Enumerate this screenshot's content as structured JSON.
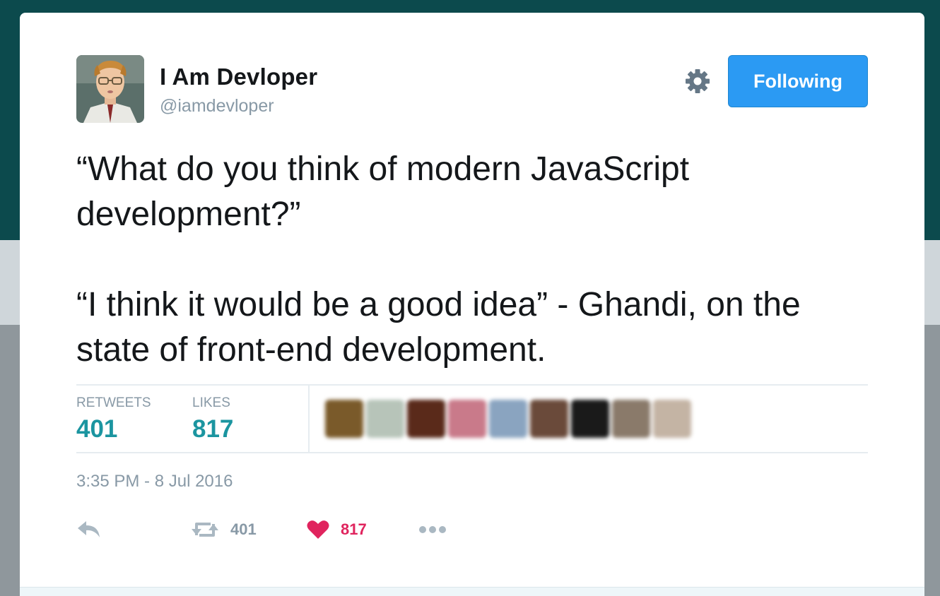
{
  "user": {
    "display_name": "I Am Devloper",
    "handle": "@iamdevloper"
  },
  "header": {
    "settings_icon": "gear-icon",
    "follow_label": "Following",
    "follow_color": "#2b9af3"
  },
  "tweet": {
    "paragraph1": "“What do you think of modern JavaScript development?”",
    "paragraph2": "“I think it would be a good idea” - Ghandi, on the state of front-end development."
  },
  "stats": {
    "retweets_label": "RETWEETS",
    "retweets_value": "401",
    "likes_label": "LIKES",
    "likes_value": "817",
    "liker_avatar_colors": [
      "#7a5a2a",
      "#b7c4b9",
      "#5a2a1a",
      "#c97a8a",
      "#8aa4c0",
      "#6a4a3a",
      "#1a1a1a",
      "#8a7a6a",
      "#c4b4a4"
    ]
  },
  "timestamp": "3:35 PM - 8 Jul 2016",
  "actions": {
    "reply_icon": "reply-icon",
    "retweet_icon": "retweet-icon",
    "retweet_count": "401",
    "like_icon": "heart-icon",
    "like_count": "817",
    "like_color": "#e0245e",
    "more_icon": "more-dots-icon"
  },
  "colors": {
    "accent_teal": "#1b95a0",
    "muted_text": "#8899a6",
    "header_background": "#0c4a4d"
  }
}
